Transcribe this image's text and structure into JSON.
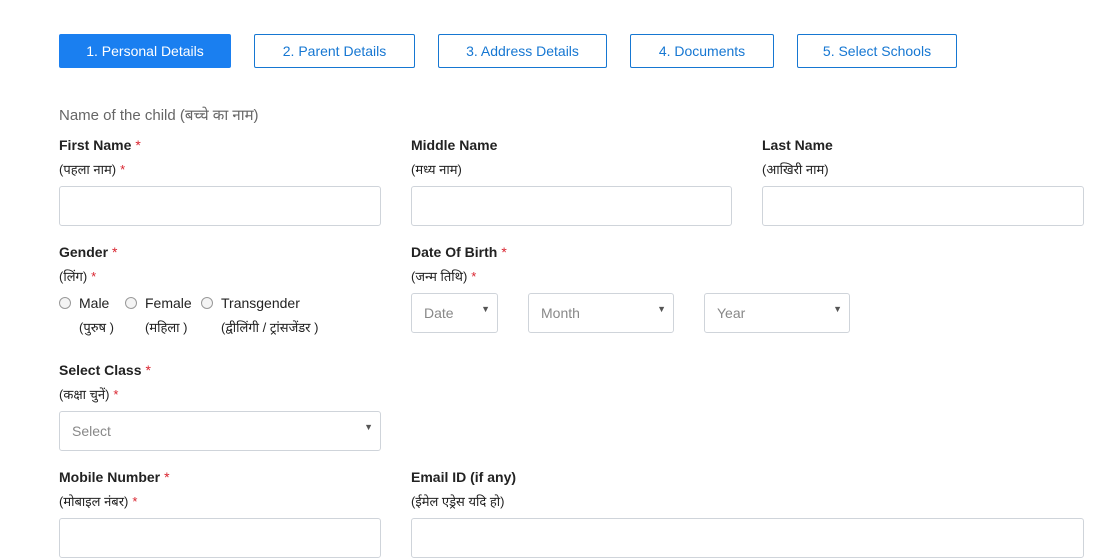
{
  "tabs": [
    {
      "label": "1. Personal Details",
      "active": true
    },
    {
      "label": "2. Parent Details",
      "active": false
    },
    {
      "label": "3. Address Details",
      "active": false
    },
    {
      "label": "4. Documents",
      "active": false
    },
    {
      "label": "5. Select Schools",
      "active": false
    }
  ],
  "section_title": "Name of the child (बच्चे का नाम)",
  "first_name": {
    "label": "First Name",
    "sub": "(पहला नाम)",
    "required": "*"
  },
  "middle_name": {
    "label": "Middle Name",
    "sub": "(मध्य नाम)"
  },
  "last_name": {
    "label": "Last Name",
    "sub": "(आखिरी नाम)"
  },
  "gender": {
    "label": "Gender",
    "sub": "(लिंग)",
    "required": "*",
    "options": [
      {
        "label": "Male",
        "sub": "(पुरुष )"
      },
      {
        "label": "Female",
        "sub": "(महिला )"
      },
      {
        "label": "Transgender",
        "sub": "(द्वीलिंगी / ट्रांसजेंडर )"
      }
    ]
  },
  "dob": {
    "label": "Date Of Birth",
    "sub": "(जन्म तिथि)",
    "required": "*",
    "date": "Date",
    "month": "Month",
    "year": "Year"
  },
  "select_class": {
    "label": "Select Class",
    "sub": "(कक्षा चुनें)",
    "required": "*",
    "placeholder": "Select"
  },
  "mobile": {
    "label": "Mobile Number",
    "sub": "(मोबाइल नंबर)",
    "required": "*"
  },
  "email": {
    "label": "Email ID (if any)",
    "sub": "(ईमेल एड्रेस यदि हो)"
  },
  "icons": {
    "caret": "▼"
  }
}
